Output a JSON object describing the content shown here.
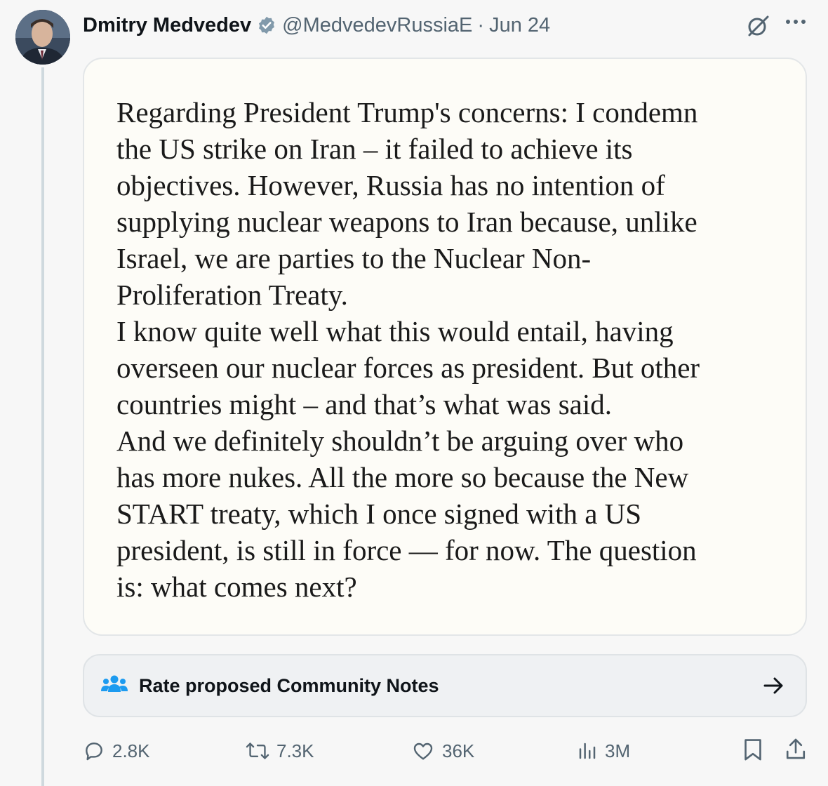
{
  "post": {
    "author": {
      "display_name": "Dmitry Medvedev",
      "handle": "@MedvedevRussiaE",
      "verified": true
    },
    "separator": "·",
    "date": "Jun 24",
    "media_text": [
      "Regarding President Trump's concerns: I condemn",
      "the US strike on Iran – it failed to achieve its",
      "objectives. However, Russia has no intention of",
      "supplying nuclear weapons to Iran because, unlike",
      "Israel, we are parties to the Nuclear Non-",
      "Proliferation Treaty.",
      "I know quite well what this would entail, having",
      "overseen our nuclear forces as president. But other",
      "countries might – and that’s what was said.",
      "And we definitely shouldn’t be arguing over who",
      "has more nukes. All the more so because the New",
      "START treaty, which I once signed with a US",
      "president, is still in force — for now. The question",
      "is: what comes next?"
    ]
  },
  "community_notes": {
    "label": "Rate proposed Community Notes",
    "icon": "people-icon"
  },
  "actions": {
    "replies": "2.8K",
    "reposts": "7.3K",
    "likes": "36K",
    "views": "3M"
  },
  "colors": {
    "secondary_text": "#536471",
    "accent_blue": "#1d9bf0",
    "notes_blue": "#1d9bf0"
  },
  "icons": [
    "verified-badge-icon",
    "grok-icon",
    "more-icon",
    "people-icon",
    "arrow-right-icon",
    "reply-icon",
    "repost-icon",
    "like-icon",
    "views-icon",
    "bookmark-icon",
    "share-icon"
  ]
}
